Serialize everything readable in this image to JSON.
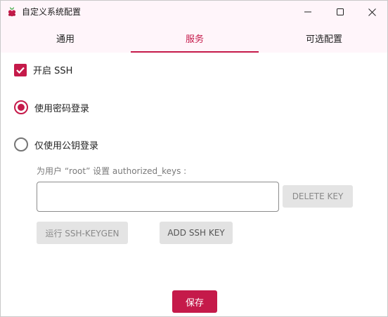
{
  "window": {
    "title": "自定义系统配置",
    "app_icon": "raspberry-icon",
    "controls": {
      "minimize": "minimize-icon",
      "maximize": "maximize-icon",
      "close": "close-icon"
    }
  },
  "tabs": [
    {
      "label": "通用",
      "active": false
    },
    {
      "label": "服务",
      "active": true
    },
    {
      "label": "可选配置",
      "active": false
    }
  ],
  "ssh": {
    "enable_label": "开启 SSH",
    "enabled": true,
    "password_login_label": "使用密码登录",
    "pubkey_login_label": "仅使用公钥登录",
    "selected": "password",
    "keys_caption": "为用户 “root” 设置 authorized_keys :",
    "key_value": "",
    "delete_key_label": "DELETE KEY",
    "keygen_label": "运行 SSH-KEYGEN",
    "add_key_label": "ADD SSH KEY"
  },
  "footer": {
    "save_label": "保存"
  },
  "colors": {
    "accent": "#c51a4a",
    "tab_bg": "#fff5fa",
    "disabled_button": "#e4e4e4"
  }
}
